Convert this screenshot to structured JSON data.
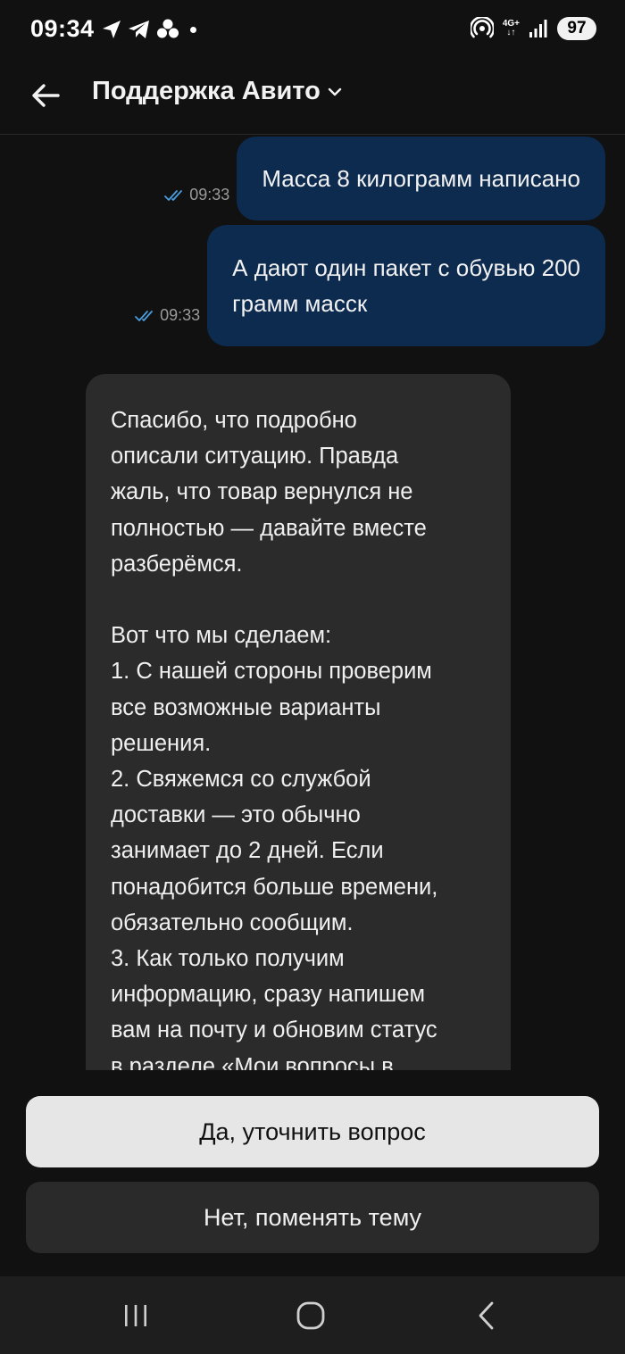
{
  "status_bar": {
    "time": "09:34",
    "battery": "97",
    "network_top": "4G+",
    "network_bottom": "↓↑",
    "icons_left": [
      "navigation-arrow-icon",
      "telegram-icon",
      "flower-app-icon",
      "notification-dot-icon"
    ],
    "icons_right": [
      "hotspot-icon",
      "network-4g-icon",
      "signal-icon",
      "battery-badge"
    ]
  },
  "header": {
    "title": "Поддержка Авито",
    "back_icon": "back-arrow-icon",
    "dropdown_icon": "chevron-down-icon"
  },
  "messages": [
    {
      "direction": "outgoing",
      "time": "09:33",
      "status_icon": "double-check-icon",
      "lines": [
        "Масса 8 килограмм написано"
      ]
    },
    {
      "direction": "outgoing",
      "time": "09:33",
      "status_icon": "double-check-icon",
      "lines": [
        "А дают один пакет с обувью 200",
        "грамм масск"
      ]
    },
    {
      "direction": "incoming",
      "paragraphs": [
        [
          "Спасибо, что подробно",
          "описали ситуацию. Правда",
          "жаль, что товар вернулся не",
          "полностью — давайте вместе",
          "разберёмся."
        ],
        [
          "Вот что мы сделаем:",
          "1. С нашей стороны проверим",
          "все возможные варианты",
          "решения.",
          "2. Свяжемся со службой",
          "доставки — это обычно",
          "занимает до 2 дней. Если",
          "понадобится больше времени,",
          "обязательно сообщим.",
          "3. Как только получим",
          "информацию, сразу напишем",
          "вам на почту и обновим статус",
          "в разделе «Мои вопросы в"
        ]
      ]
    }
  ],
  "actions": {
    "primary": "Да, уточнить вопрос",
    "secondary": "Нет, поменять тему"
  },
  "nav_bar": {
    "recents_icon": "recents-icon",
    "home_icon": "home-icon",
    "back_icon": "nav-back-icon"
  },
  "colors": {
    "background": "#111111",
    "outgoing_bubble": "#0d2a4f",
    "incoming_bubble": "#2b2b2b",
    "check_mark": "#4a9de0",
    "primary_button": "#e6e6e6",
    "secondary_button": "#2a2a2a"
  }
}
